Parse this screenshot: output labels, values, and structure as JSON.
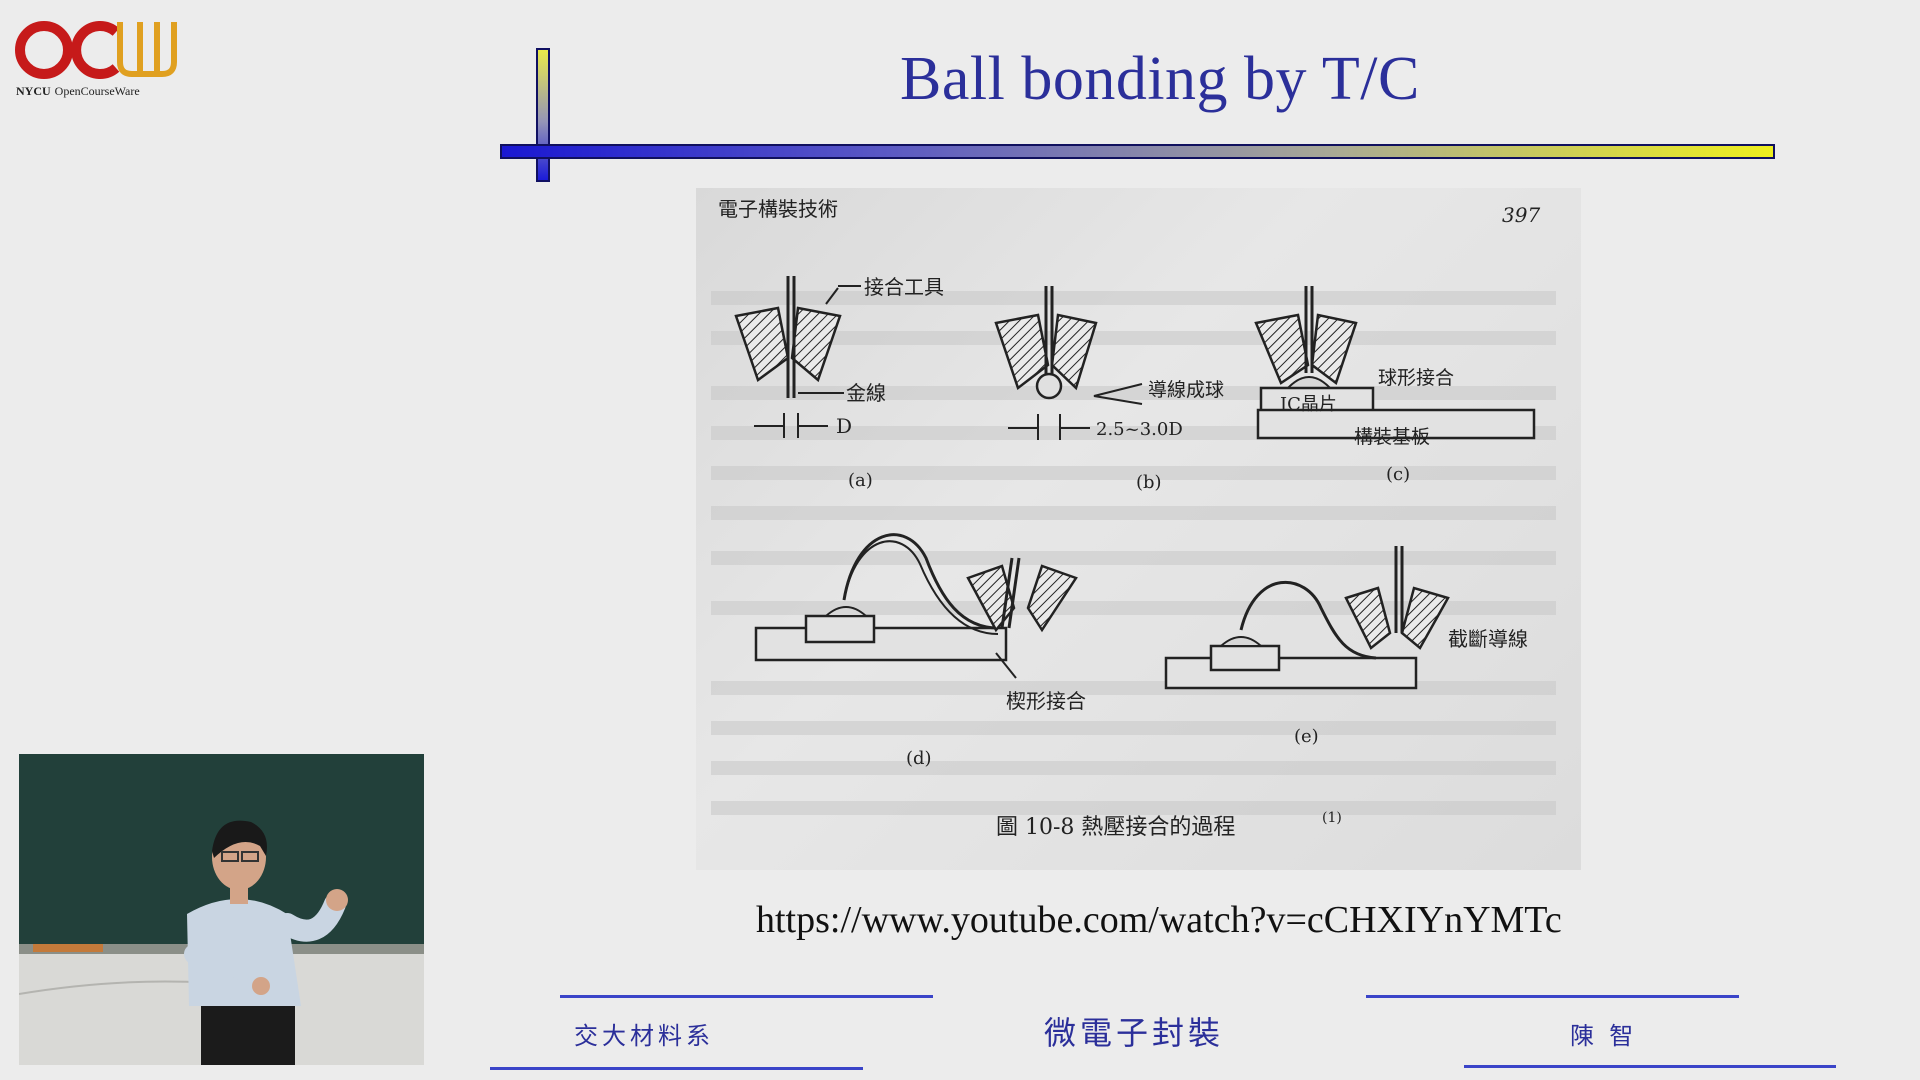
{
  "logo": {
    "letters": "OCW",
    "caption_bold": "NYCU",
    "caption_rest": "OpenCourseWare"
  },
  "slide": {
    "title": "Ball bonding by T/C",
    "url": "https://www.youtube.com/watch?v=cCHXIYnYMTc",
    "footer": {
      "left": "交大材料系",
      "center": "微電子封裝",
      "right": "陳  智"
    }
  },
  "figure": {
    "header": "電子構裝技術",
    "page_number": "397",
    "labels": {
      "tool": "接合工具",
      "gold_wire": "金線",
      "d": "D",
      "ball": "導線成球",
      "dim": "2.5~3.0D",
      "ball_bond": "球形接合",
      "ic_chip": "IC晶片",
      "substrate": "構裝基板",
      "wedge": "楔形接合",
      "cut": "截斷導線",
      "a": "(a)",
      "b": "(b)",
      "c": "(c)",
      "d_panel": "(d)",
      "e": "(e)"
    },
    "caption": "圖 10-8   熱壓接合的過程",
    "caption_ref": "(1)"
  },
  "video": {
    "description": "lecturer"
  }
}
